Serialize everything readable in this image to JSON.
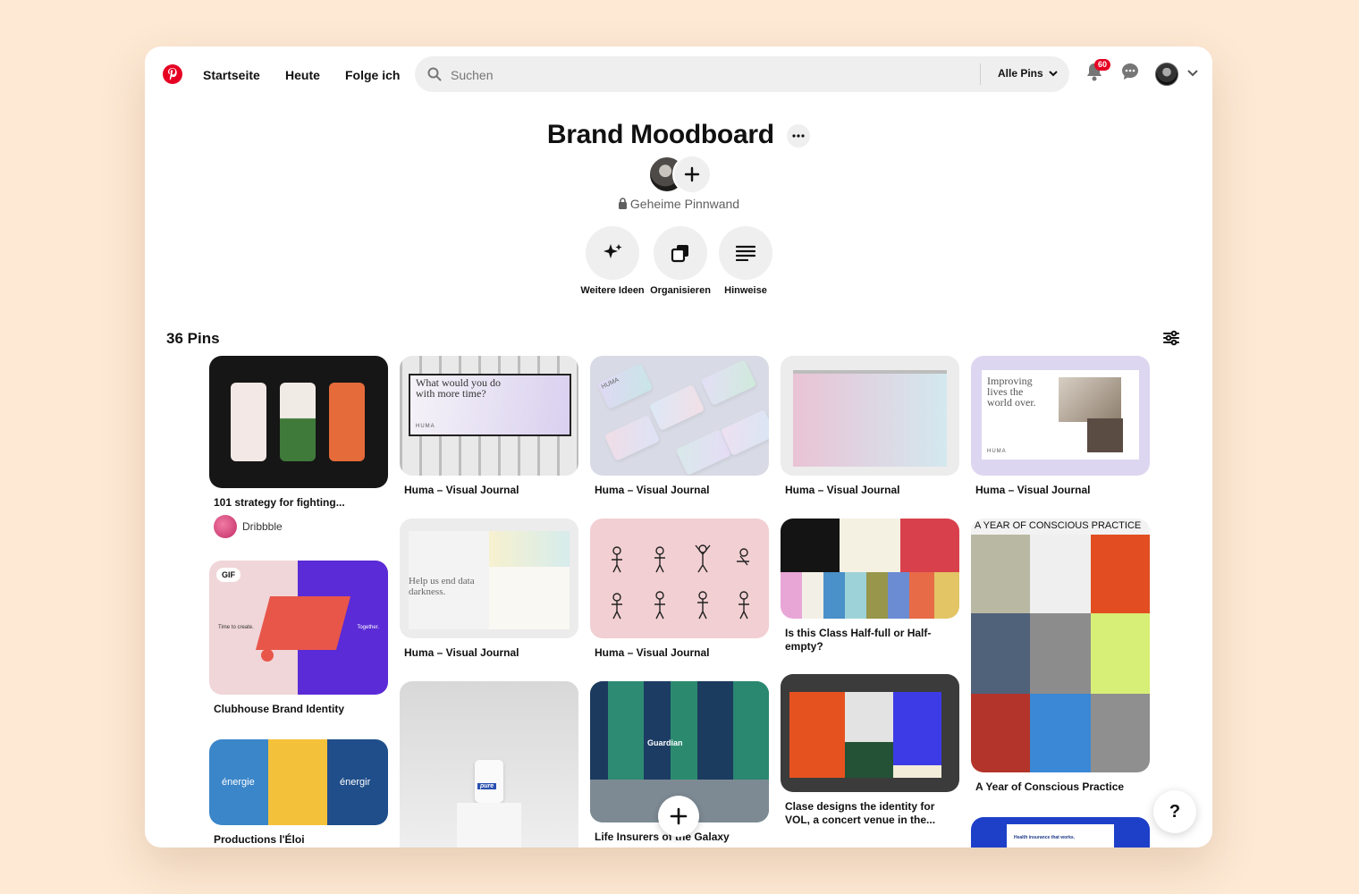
{
  "nav": {
    "home": "Startseite",
    "today": "Heute",
    "following": "Folge ich"
  },
  "search": {
    "placeholder": "Suchen",
    "filter_label": "Alle Pins"
  },
  "notifications": {
    "count": "60"
  },
  "board": {
    "title": "Brand Moodboard",
    "visibility": "Geheime Pinnwand",
    "actions": [
      {
        "label": "Weitere Ideen",
        "icon": "sparkle-icon"
      },
      {
        "label": "Organisieren",
        "icon": "organize-icon"
      },
      {
        "label": "Hinweise",
        "icon": "notes-icon"
      }
    ],
    "pin_count": "36 Pins"
  },
  "pins": {
    "p1": {
      "caption": "101 strategy for fighting...",
      "source": "Dribbble"
    },
    "p2": {
      "caption": "Clubhouse Brand Identity",
      "tag": "GIF",
      "left_text": "Time to create.",
      "right_text": "Together."
    },
    "p3": {
      "caption": "Productions l'Éloi",
      "words": [
        "énergie",
        "énergir"
      ]
    },
    "p4": {
      "caption": "Huma – Visual Journal",
      "headline": "What would you do with more time?",
      "brand": "HUMA"
    },
    "p5": {
      "caption": "Huma – Visual Journal",
      "headline": "Help us end data darkness."
    },
    "p6": {
      "caption": "",
      "label": "pure"
    },
    "p7": {
      "caption": "Huma – Visual Journal",
      "brand": "HUMA"
    },
    "p8": {
      "caption": "Huma – Visual Journal"
    },
    "p9": {
      "caption": "Life Insurers of the Galaxy",
      "brand": "Guardian"
    },
    "p10": {
      "caption": "Huma – Visual Journal"
    },
    "p11": {
      "caption": "Is this Class Half-full or Half-empty?"
    },
    "p12": {
      "caption": "Clase designs the identity for VOL, a concert venue in the..."
    },
    "p13": {
      "caption": "Huma – Visual Journal",
      "headline": "Improving lives the world over.",
      "brand": "HUMA"
    },
    "p14": {
      "caption": "A Year of Conscious Practice",
      "header": "A YEAR OF CONSCIOUS PRACTICE"
    },
    "p15": {
      "headline": "Health insurance that works."
    }
  },
  "help": {
    "label": "?"
  }
}
